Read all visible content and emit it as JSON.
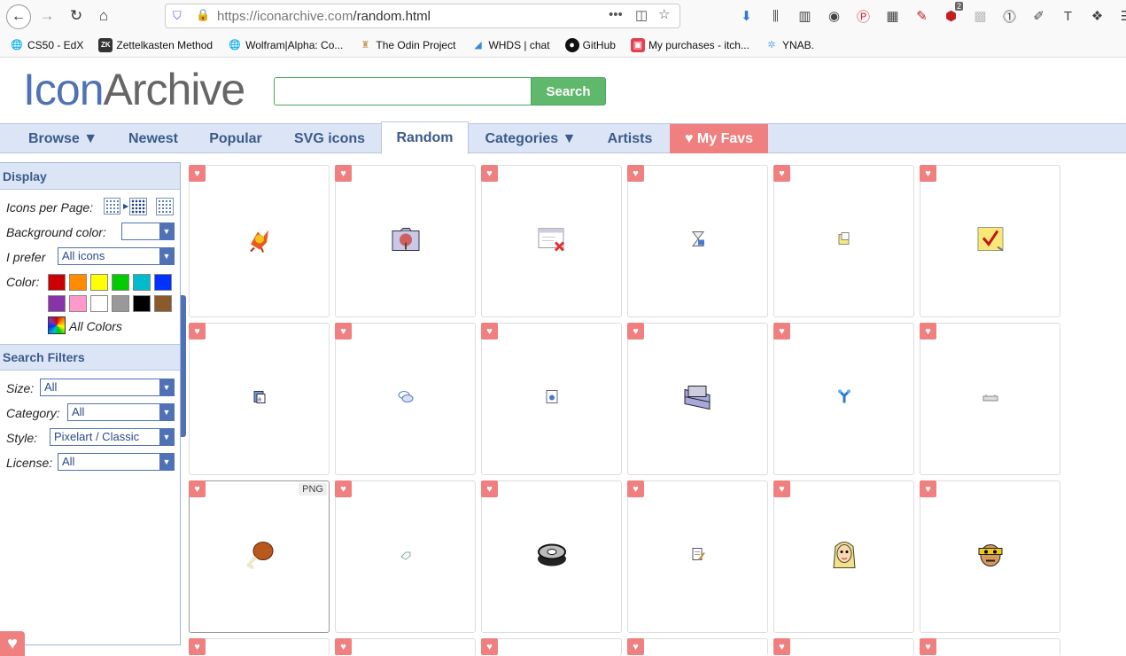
{
  "browser": {
    "url_host": "https://iconarchive.com",
    "url_path": "/random.html",
    "bookmarks": [
      {
        "label": "CS50 - EdX",
        "icon": "globe-icon"
      },
      {
        "label": "Zettelkasten Method",
        "icon": "zk-icon"
      },
      {
        "label": "Wolfram|Alpha: Co...",
        "icon": "globe-icon"
      },
      {
        "label": "The Odin Project",
        "icon": "odin-icon"
      },
      {
        "label": "WHDS | chat",
        "icon": "chat-icon"
      },
      {
        "label": "GitHub",
        "icon": "github-icon"
      },
      {
        "label": "My purchases - itch...",
        "icon": "itch-icon"
      },
      {
        "label": "YNAB.",
        "icon": "ynab-icon"
      }
    ],
    "badge_count": "2"
  },
  "site": {
    "logo_part1": "Icon",
    "logo_part2": "Archive",
    "search_value": "",
    "search_label": "Search"
  },
  "nav": [
    {
      "label": "Browse ▼"
    },
    {
      "label": "Newest"
    },
    {
      "label": "Popular"
    },
    {
      "label": "SVG icons"
    },
    {
      "label": "Random"
    },
    {
      "label": "Categories ▼"
    },
    {
      "label": "Artists"
    },
    {
      "label": "♥ My Favs"
    }
  ],
  "sidebar": {
    "display_heading": "Display",
    "icons_per_page_label": "Icons per Page:",
    "bg_color_label": "Background color:",
    "prefer_label": "I prefer",
    "prefer_value": "All icons",
    "color_label": "Color:",
    "colors": [
      "#cc0000",
      "#ff8c00",
      "#ffff00",
      "#00cc00",
      "#00bbcc",
      "#0033ff",
      "#8833aa",
      "#ff99cc",
      "#ffffff",
      "#999999",
      "#000000",
      "#8b5a2b"
    ],
    "all_colors_label": "All Colors",
    "filters_heading": "Search Filters",
    "size_label": "Size:",
    "size_value": "All",
    "category_label": "Category:",
    "category_value": "All",
    "style_label": "Style:",
    "style_value": "Pixelart / Classic",
    "license_label": "License:",
    "license_value": "All"
  },
  "grid": {
    "png_badge": "PNG",
    "icons": [
      "phoenix-icon",
      "folder-tree-icon",
      "window-close-icon",
      "hourglass-icon",
      "note-icon",
      "checklist-icon",
      "document-icon",
      "chat-bubble-icon",
      "webpage-icon",
      "folder-cards-icon",
      "network-icon",
      "drive-icon",
      "drumstick-icon",
      "tag-icon",
      "film-reel-icon",
      "edit-document-icon",
      "blonde-face-icon",
      "masked-face-icon"
    ]
  }
}
